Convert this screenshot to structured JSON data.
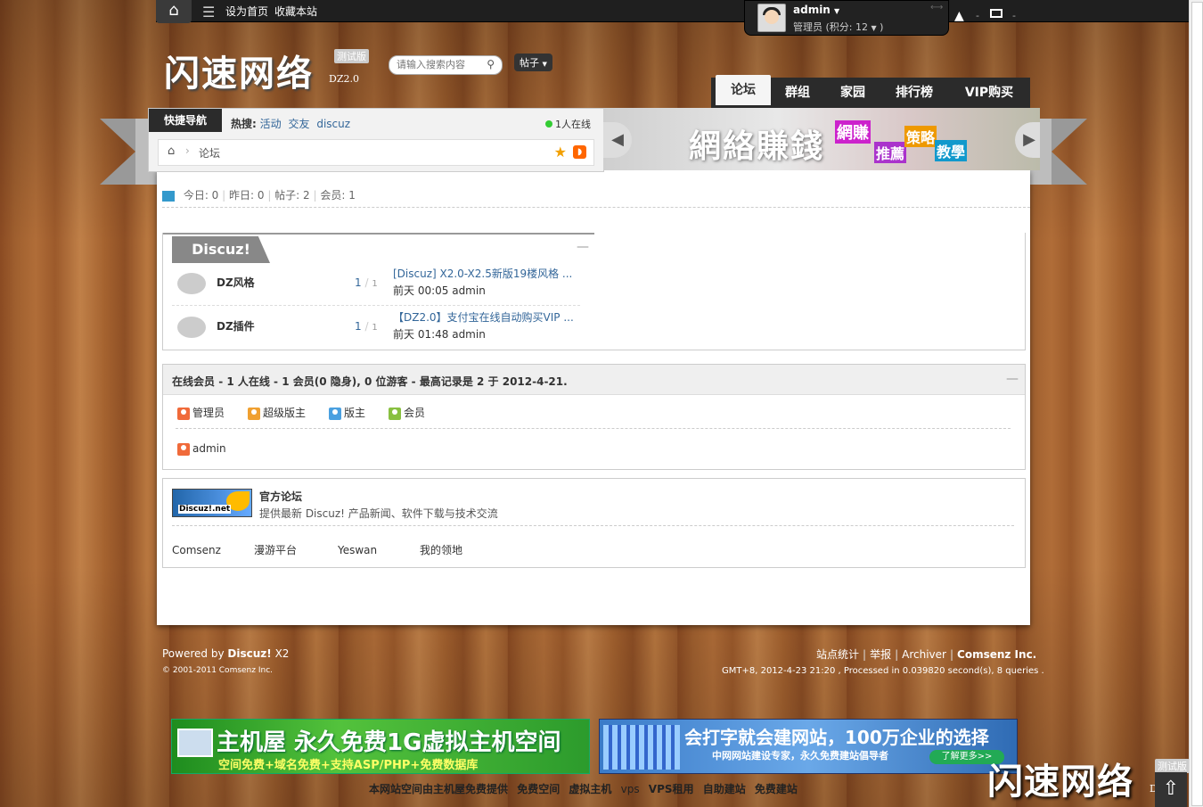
{
  "topbar": {
    "set_home": "设为首页",
    "bookmark": "收藏本站",
    "username": "admin",
    "role": "管理员",
    "credits": "(积分: 12",
    "credits_end": ")",
    "dash": "-"
  },
  "header": {
    "logo": "闪速网络",
    "badge": "测试版",
    "sub": "DZ2.0",
    "search_placeholder": "请输入搜索内容",
    "search_type": "帖子"
  },
  "nav": [
    {
      "label": "论坛",
      "active": true
    },
    {
      "label": "群组"
    },
    {
      "label": "家园"
    },
    {
      "label": "排行榜"
    },
    {
      "label": "VIP购买"
    }
  ],
  "quick": {
    "label": "快捷导航",
    "hot_label": "热搜:",
    "hot_tags": [
      "活动",
      "交友",
      "discuz"
    ],
    "online": "1人在线",
    "breadcrumb": "论坛"
  },
  "banner": {
    "text": "網絡賺錢",
    "tags": [
      "網賺",
      "推薦",
      "策略",
      "教學"
    ]
  },
  "stats": {
    "today": "今日: 0",
    "yesterday": "昨日: 0",
    "posts": "帖子: 2",
    "members": "会员: 1"
  },
  "forum": {
    "category": "Discuz!",
    "collapse": "—",
    "rows": [
      {
        "name": "DZ风格",
        "count": "1",
        "total": "1",
        "last_title": "[Discuz] X2.0-X2.5新版19楼风格 ...",
        "last_time": "前天 00:05 admin"
      },
      {
        "name": "DZ插件",
        "count": "1",
        "total": "1",
        "last_title": "【DZ2.0】支付宝在线自动购买VIP ...",
        "last_time": "前天 01:48 admin"
      }
    ]
  },
  "online": {
    "title": "在线会员",
    "summary": " - 1 人在线  - 1 会员(0 隐身), 0 位游客  - 最高记录是  2 于  2012-4-21.",
    "collapse": "—",
    "legend": [
      "管理员",
      "超级版主",
      "版主",
      "会员"
    ],
    "users": [
      "admin"
    ]
  },
  "links": {
    "dz_logo_text": "Discuz!.net",
    "official_title": "官方论坛",
    "official_desc": "提供最新  Discuz! 产品新闻、软件下载与技术交流",
    "friends": [
      "Comsenz",
      "漫游平台",
      "Yeswan",
      "我的领地"
    ]
  },
  "footer": {
    "powered": "Powered by",
    "product": "Discuz!",
    "version": "X2",
    "copyright": "© 2001-2011 Comsenz Inc.",
    "links": [
      "站点统计",
      "举报",
      "Archiver",
      "Comsenz Inc."
    ],
    "processed": "GMT+8, 2012-4-23 21:20 , Processed in 0.039820 second(s), 8 queries ."
  },
  "ads": {
    "ad1_title": "主机屋 永久免费1G虚拟主机空间",
    "ad1_sub": "空间免费+域名免费+支持ASP/PHP+免费数据库",
    "ad2_title": "会打字就会建网站，100万企业的选择",
    "ad2_sub": "中网网站建设专家，永久免费建站倡导者",
    "ad2_btn": "了解更多>>",
    "bottom_links": [
      "本网站空间由主机屋免费提供",
      "免费空间",
      "虚拟主机",
      "vps",
      "VPS租用",
      "自助建站",
      "免费建站"
    ]
  },
  "colors": {
    "link": "#336699",
    "topbar": "#1f1f1f",
    "admin_icon": "#f06a3a",
    "supermod_icon": "#f0a030",
    "mod_icon": "#4aa0e0",
    "member_icon": "#88c040"
  }
}
